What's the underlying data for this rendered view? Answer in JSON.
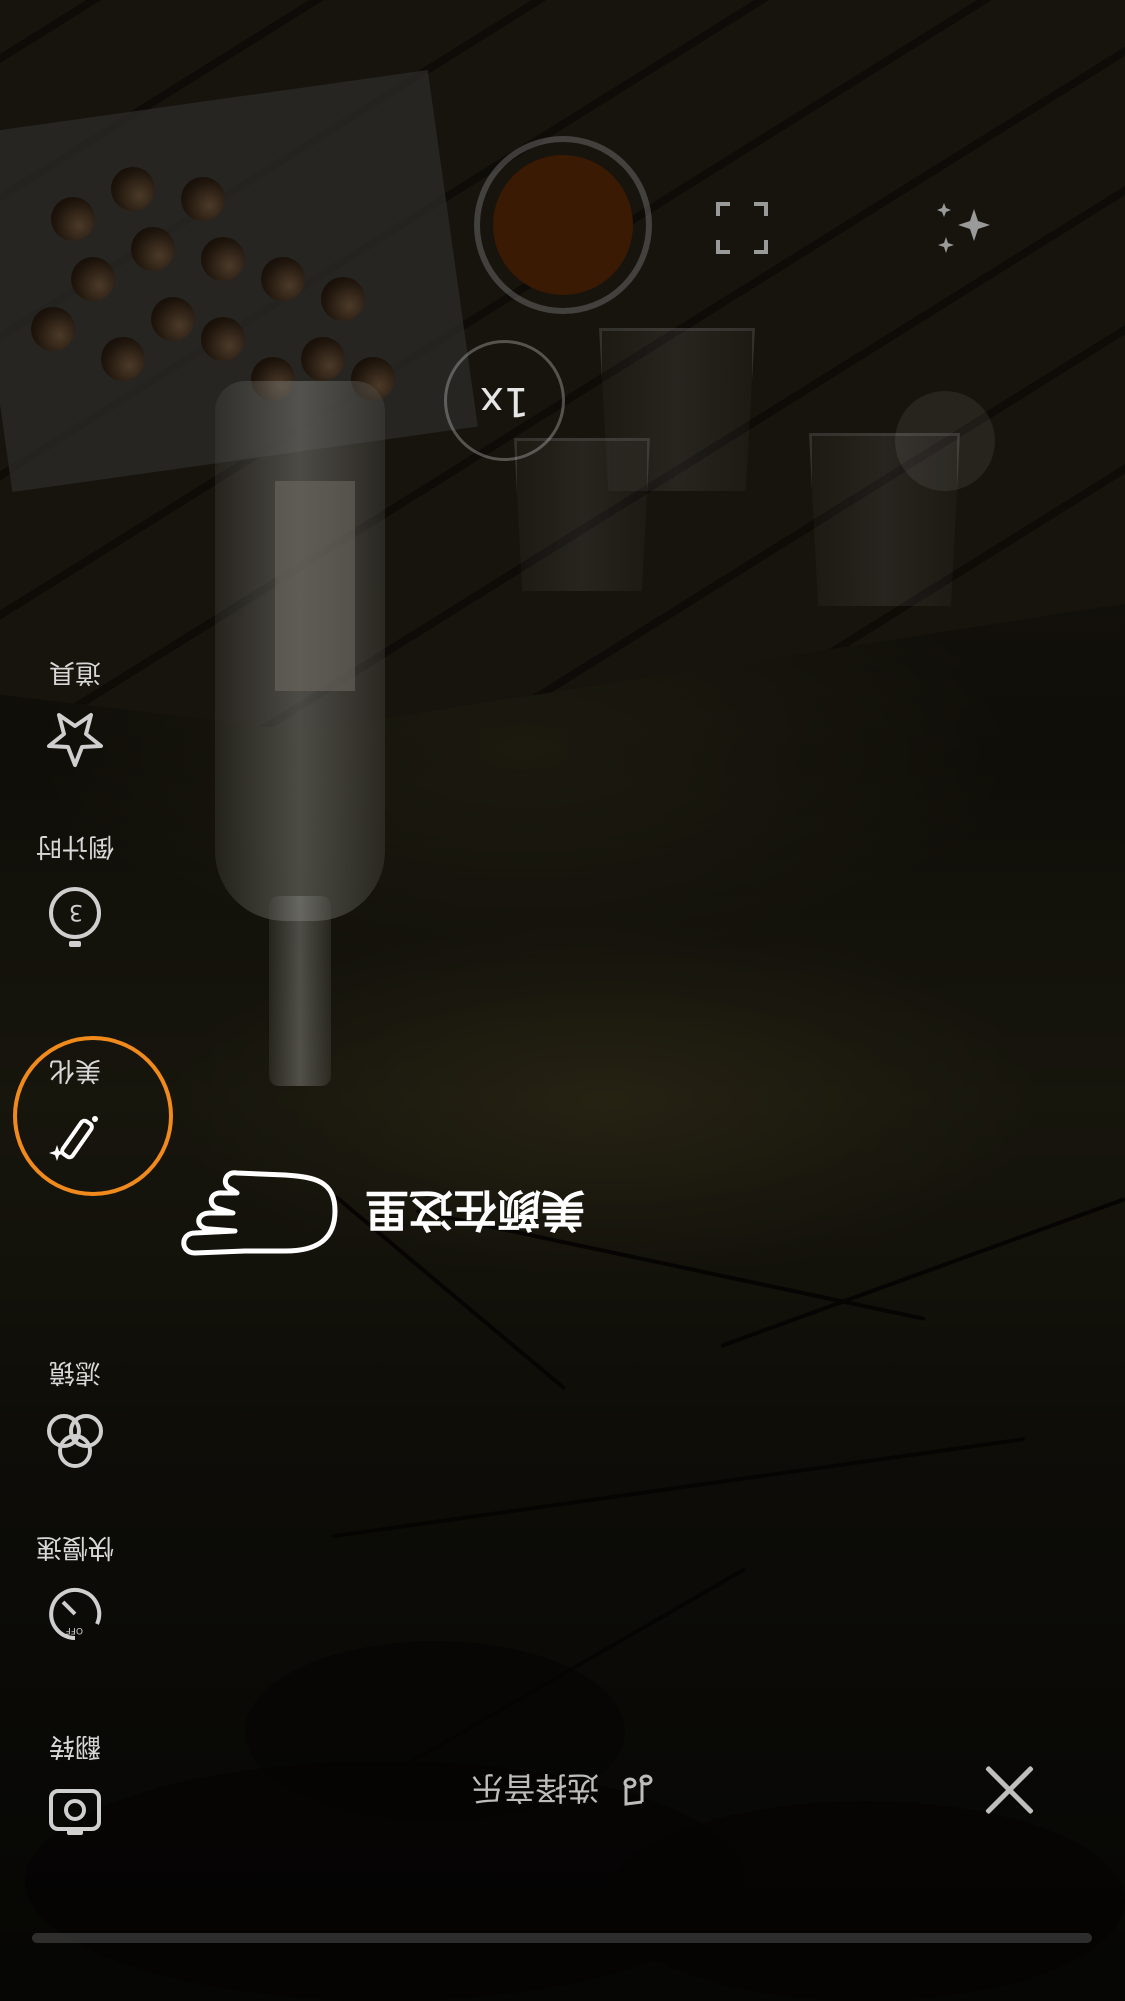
{
  "music": {
    "note_icon": "music-note-icon",
    "label": "选择音乐"
  },
  "zoom": {
    "label": "1x"
  },
  "hint": {
    "text": "美颜在这里"
  },
  "sidebar": {
    "items": [
      {
        "name": "flip",
        "icon": "camera-flip-icon",
        "label": "翻转"
      },
      {
        "name": "speed",
        "icon": "speed-icon",
        "label": "快慢速",
        "icon_badge": "OFF"
      },
      {
        "name": "filter",
        "icon": "filter-icon",
        "label": "滤镜"
      },
      {
        "name": "beauty",
        "icon": "magic-wand-icon",
        "label": "美化"
      },
      {
        "name": "timer",
        "icon": "timer-icon",
        "label": "倒计时",
        "icon_badge": "3"
      },
      {
        "name": "props",
        "icon": "star-icon",
        "label": "道具"
      }
    ]
  },
  "colors": {
    "accent": "#f08a1c",
    "record": "#3b1a04"
  }
}
